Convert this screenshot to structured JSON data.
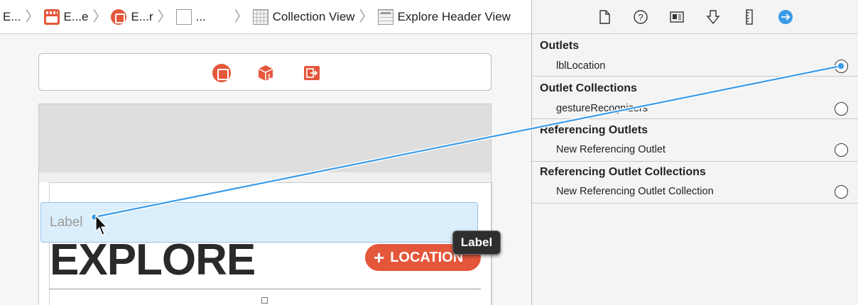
{
  "breadcrumb": {
    "items": [
      {
        "label": "E...",
        "icon": "none"
      },
      {
        "label": "E...e",
        "icon": "storyboard-icon"
      },
      {
        "label": "E...r",
        "icon": "view-controller-icon"
      },
      {
        "label": "...",
        "icon": "view-icon"
      },
      {
        "label": "Collection View",
        "icon": "collection-view-icon"
      },
      {
        "label": "Explore Header View",
        "icon": "collection-reusable-view-icon"
      }
    ]
  },
  "scene_dock": {
    "icons": [
      "view-controller-icon",
      "first-responder-icon",
      "exit-icon"
    ]
  },
  "canvas": {
    "label_placeholder": "Label",
    "heading": "EXPLORE",
    "location_button": {
      "plus": "+",
      "label": "LOCATION"
    },
    "drag_tooltip": "Label"
  },
  "inspector": {
    "toolbar_icons": [
      "file-inspector-icon",
      "quick-help-icon",
      "identity-inspector-icon",
      "attributes-inspector-icon",
      "size-inspector-icon",
      "connections-inspector-icon"
    ],
    "active_tab": "connections-inspector-icon",
    "sections": [
      {
        "title": "Outlets",
        "rows": [
          {
            "label": "lblLocation",
            "connected": true
          }
        ]
      },
      {
        "title": "Outlet Collections",
        "rows": [
          {
            "label": "gestureRecognizers",
            "connected": false
          }
        ]
      },
      {
        "title": "Referencing Outlets",
        "rows": [
          {
            "label": "New Referencing Outlet",
            "connected": false
          }
        ]
      },
      {
        "title": "Referencing Outlet Collections",
        "rows": [
          {
            "label": "New Referencing Outlet Collection",
            "connected": false
          }
        ]
      }
    ]
  },
  "colors": {
    "accent_orange": "#e4573b",
    "connection_blue": "#3a9be8",
    "selection_fill": "#dbeefb"
  }
}
